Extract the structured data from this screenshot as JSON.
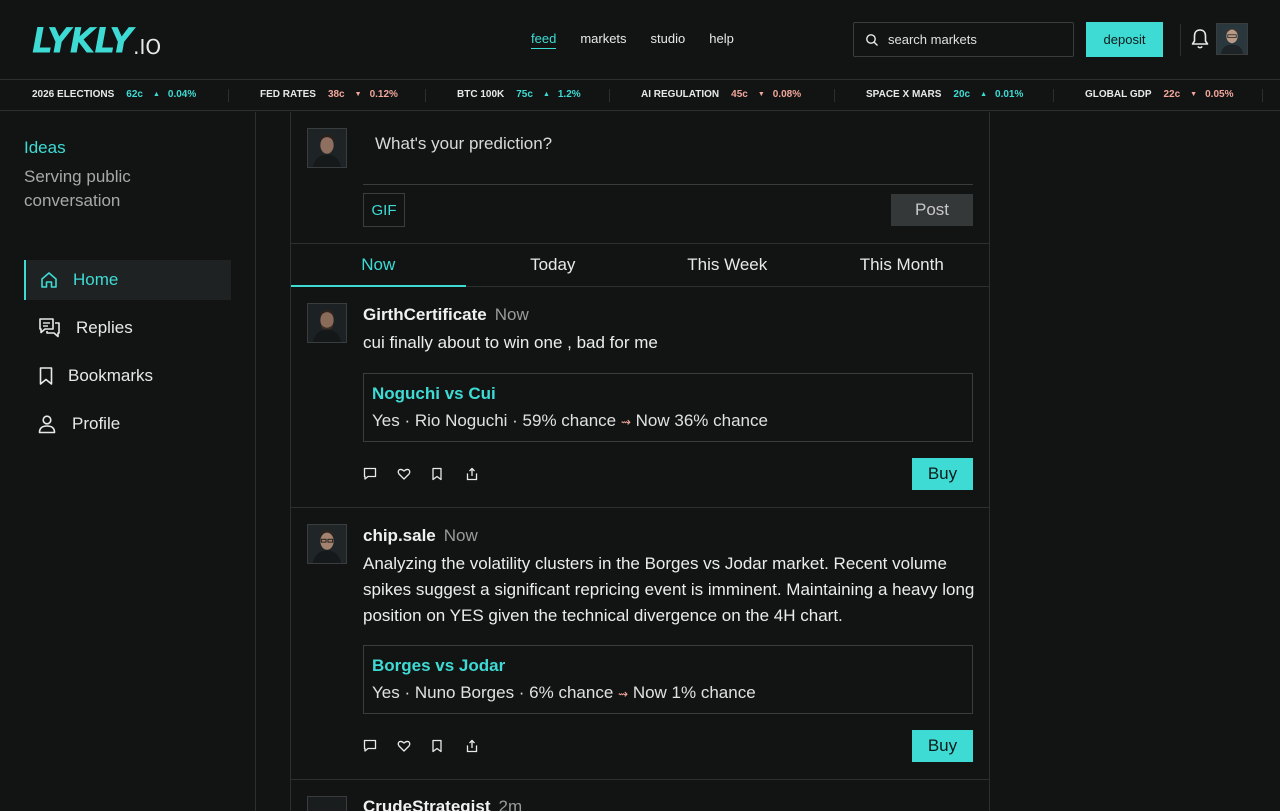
{
  "header": {
    "logo_main": "LYKLY",
    "logo_sub": ".IO",
    "nav": [
      {
        "label": "feed",
        "active": true
      },
      {
        "label": "markets",
        "active": false
      },
      {
        "label": "studio",
        "active": false
      },
      {
        "label": "help",
        "active": false
      }
    ],
    "search_placeholder": "search markets",
    "deposit_label": "deposit",
    "accent_color": "#3ddbd4"
  },
  "ticker": [
    {
      "name": "2026 ELECTIONS",
      "price": "62c",
      "direction": "up",
      "change": "0.04%"
    },
    {
      "name": "FED RATES",
      "price": "38c",
      "direction": "down",
      "change": "0.12%"
    },
    {
      "name": "BTC 100K",
      "price": "75c",
      "direction": "up",
      "change": "1.2%"
    },
    {
      "name": "AI REGULATION",
      "price": "45c",
      "direction": "down",
      "change": "0.08%"
    },
    {
      "name": "SPACE X MARS",
      "price": "20c",
      "direction": "up",
      "change": "0.01%"
    },
    {
      "name": "GLOBAL GDP",
      "price": "22c",
      "direction": "down",
      "change": "0.05%"
    }
  ],
  "sidebar": {
    "brand": "Ideas",
    "tagline": "Serving public conversation",
    "items": [
      {
        "label": "Home",
        "icon": "home-icon",
        "active": true
      },
      {
        "label": "Replies",
        "icon": "replies-icon",
        "active": false
      },
      {
        "label": "Bookmarks",
        "icon": "bookmark-icon",
        "active": false
      },
      {
        "label": "Profile",
        "icon": "profile-icon",
        "active": false
      }
    ]
  },
  "compose": {
    "placeholder": "What's your prediction?",
    "gif_label": "GIF",
    "post_label": "Post"
  },
  "tabs": [
    {
      "label": "Now",
      "active": true
    },
    {
      "label": "Today",
      "active": false
    },
    {
      "label": "This Week",
      "active": false
    },
    {
      "label": "This Month",
      "active": false
    }
  ],
  "posts": [
    {
      "username": "GirthCertificate",
      "time": "Now",
      "body": "cui finally about to win one , bad for me",
      "market_title": "Noguchi vs Cui",
      "market_line_a": "Yes · Rio Noguchi · 59% chance",
      "market_trend": "⇝",
      "market_line_b": "Now 36% chance",
      "buy_label": "Buy"
    },
    {
      "username": "chip.sale",
      "time": "Now",
      "body": "Analyzing the volatility clusters in the Borges vs Jodar market. Recent volume spikes suggest a significant repricing event is imminent. Maintaining a heavy long position on YES given the technical divergence on the 4H chart.",
      "market_title": "Borges vs Jodar",
      "market_line_a": "Yes · Nuno Borges · 6% chance",
      "market_trend": "⇝",
      "market_line_b": "Now 1% chance",
      "buy_label": "Buy"
    },
    {
      "username": "CrudeStrategist",
      "time": "2m"
    }
  ]
}
